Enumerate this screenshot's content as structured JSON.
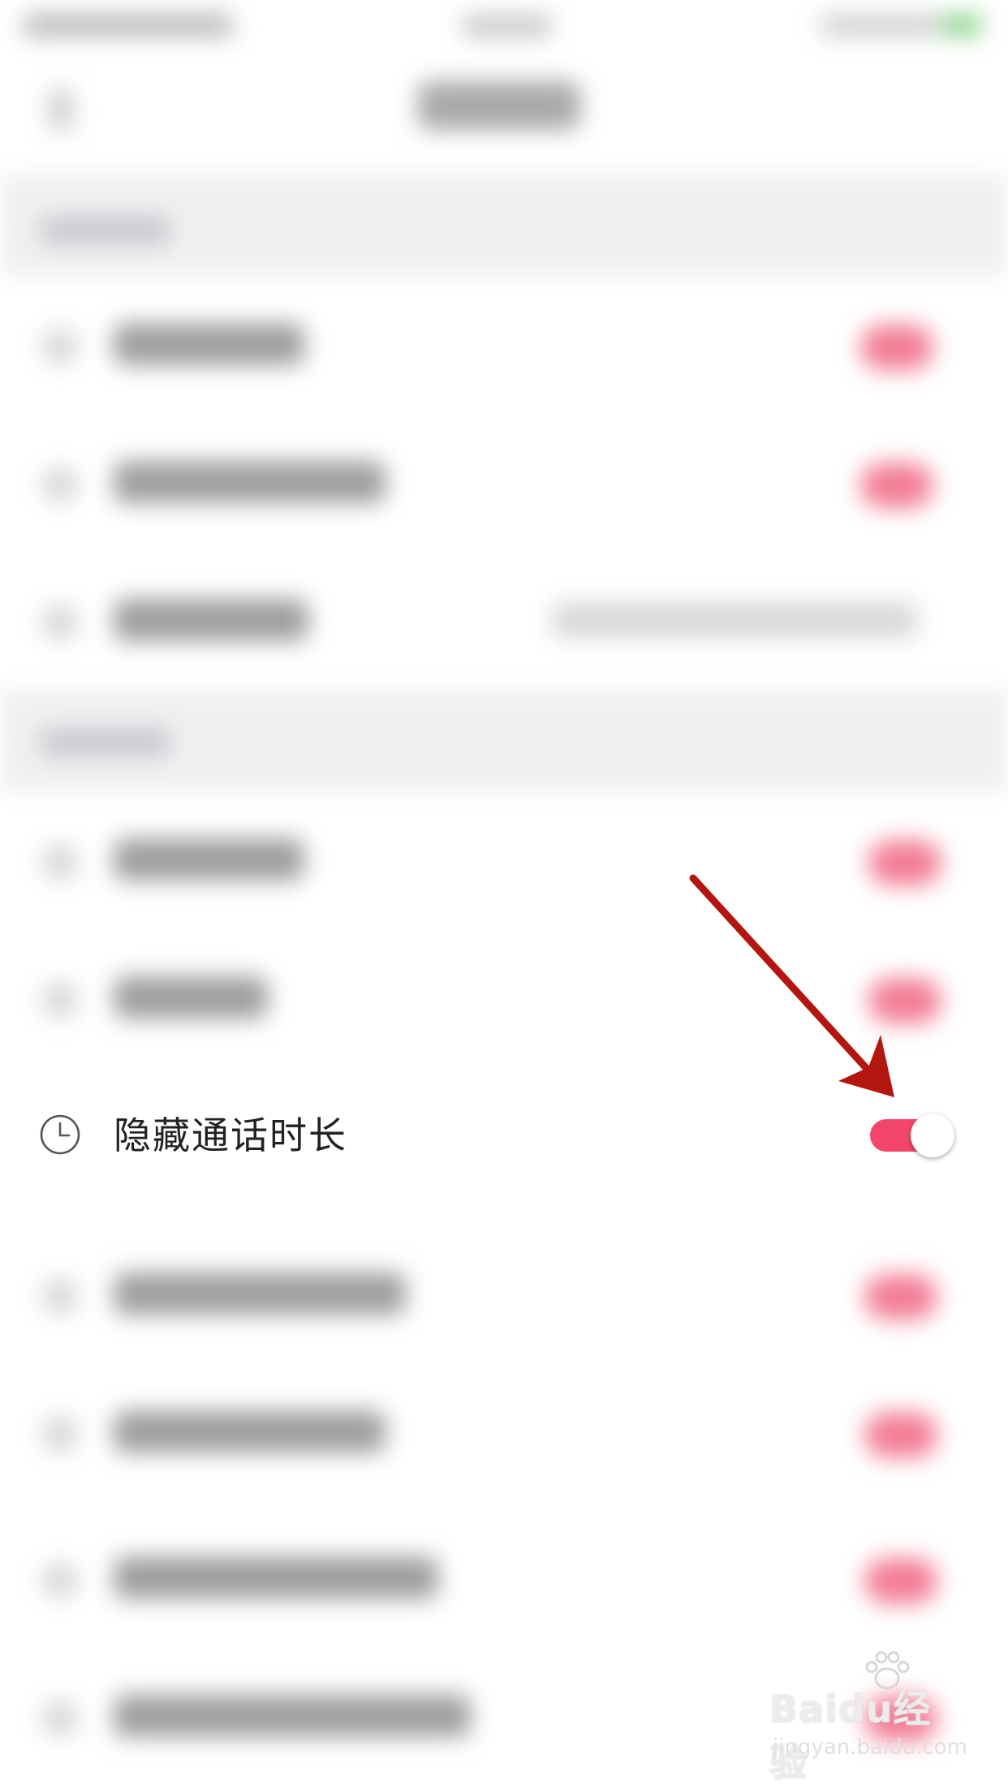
{
  "highlighted_row": {
    "label": "隐藏通话时长",
    "icon": "clock-icon",
    "toggle_on": true
  },
  "colors": {
    "toggle_on": "#f2466a",
    "arrow": "#b3160f",
    "section_bg": "#f0f0f3"
  },
  "watermark": {
    "main": "Baidu经验",
    "sub": "jingyan.baidu.com"
  }
}
